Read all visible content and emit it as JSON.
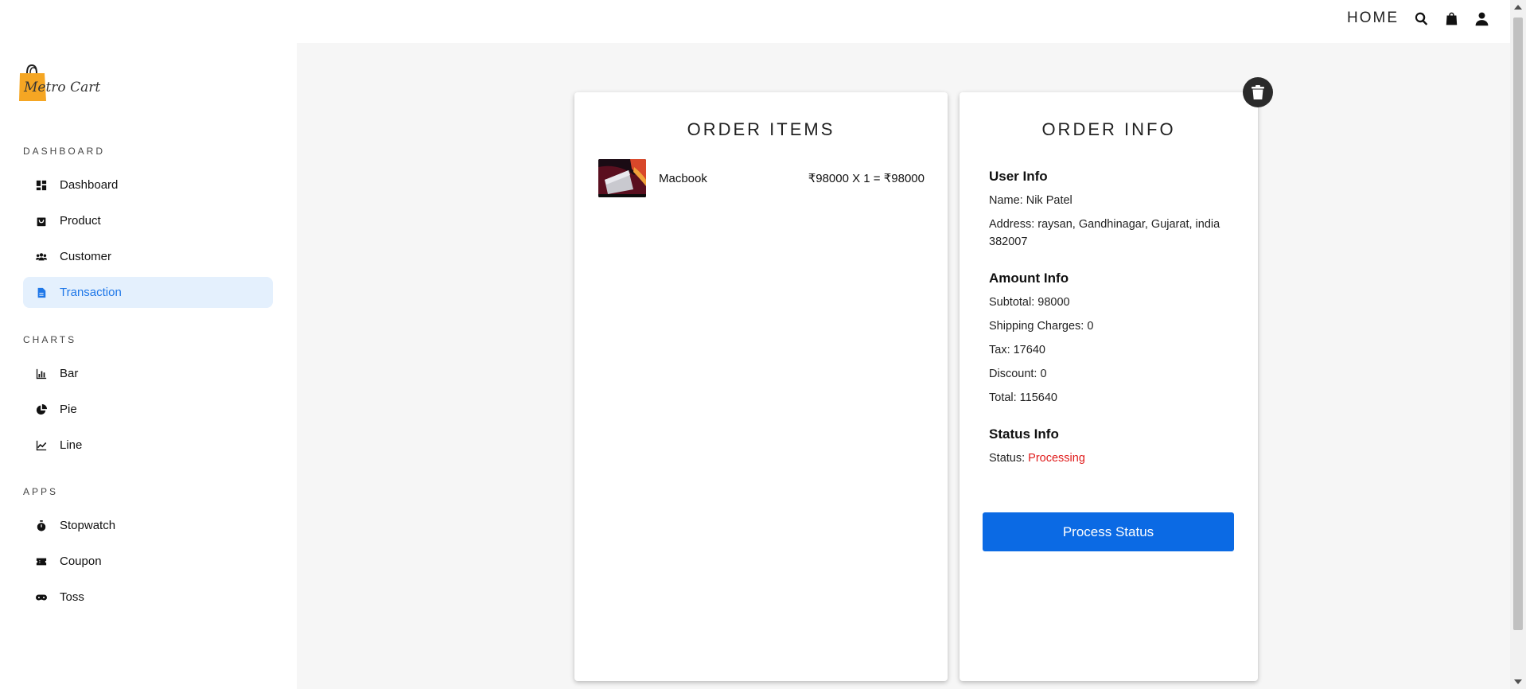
{
  "header": {
    "home_label": "HOME",
    "icons": [
      "search-icon",
      "shopping-bag-icon",
      "user-icon"
    ]
  },
  "brand": {
    "logo_text": "Metro Cart",
    "colors": {
      "bag": "#f5a623",
      "accent": "#1e77e8"
    }
  },
  "sidebar": {
    "sections": [
      {
        "title": "DASHBOARD",
        "items": [
          {
            "label": "Dashboard",
            "icon": "dashboard-icon"
          },
          {
            "label": "Product",
            "icon": "bag-icon"
          },
          {
            "label": "Customer",
            "icon": "people-icon"
          },
          {
            "label": "Transaction",
            "icon": "document-icon",
            "active": true
          }
        ]
      },
      {
        "title": "CHARTS",
        "items": [
          {
            "label": "Bar",
            "icon": "bar-chart-icon"
          },
          {
            "label": "Pie",
            "icon": "pie-chart-icon"
          },
          {
            "label": "Line",
            "icon": "line-chart-icon"
          }
        ]
      },
      {
        "title": "APPS",
        "items": [
          {
            "label": "Stopwatch",
            "icon": "stopwatch-icon"
          },
          {
            "label": "Coupon",
            "icon": "coupon-icon"
          },
          {
            "label": "Toss",
            "icon": "gamepad-icon"
          }
        ]
      }
    ]
  },
  "order_items": {
    "title": "ORDER ITEMS",
    "items": [
      {
        "name": "Macbook",
        "price_text": "₹98000 X 1 = ₹98000"
      }
    ]
  },
  "order_info": {
    "title": "ORDER INFO",
    "user": {
      "heading": "User Info",
      "name": "Name: Nik Patel",
      "address": "Address: raysan, Gandhinagar, Gujarat, india 382007"
    },
    "amount": {
      "heading": "Amount Info",
      "subtotal": "Subtotal: 98000",
      "shipping": "Shipping Charges: 0",
      "tax": "Tax: 17640",
      "discount": "Discount: 0",
      "total": "Total: 115640"
    },
    "status": {
      "heading": "Status Info",
      "label": "Status:",
      "value": "Processing",
      "value_color": "#e01b1b"
    },
    "process_button": "Process Status"
  }
}
